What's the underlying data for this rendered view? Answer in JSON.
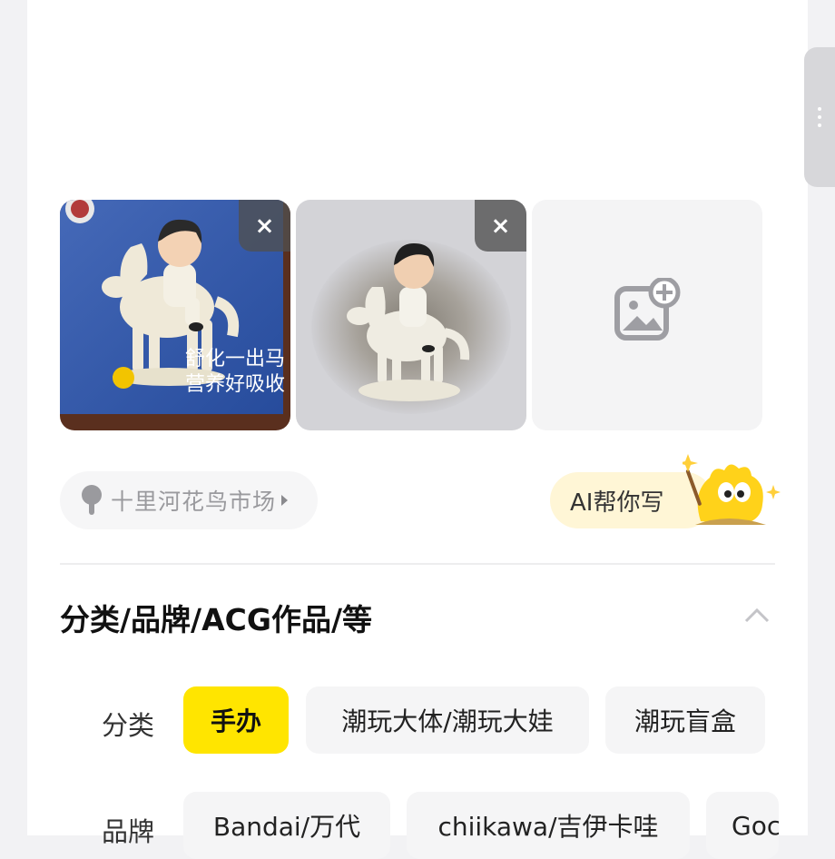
{
  "photos": [
    {
      "alt": "box figure photo",
      "close": "×",
      "box_text_line1": "舒化一出马",
      "box_text_line2": "营养好吸收"
    },
    {
      "alt": "figure photo",
      "close": "×"
    }
  ],
  "add_photo": {
    "icon": "add-image-icon"
  },
  "location": {
    "text": "十里河花鸟市场",
    "icon": "location-pin-icon"
  },
  "ai_writer": {
    "label": "AI帮你写"
  },
  "section": {
    "title": "分类/品牌/ACG作品/等"
  },
  "category_row": {
    "label": "分类",
    "chips": [
      {
        "label": "手办",
        "active": true
      },
      {
        "label": "潮玩大体/潮玩大娃",
        "active": false
      },
      {
        "label": "潮玩盲盒",
        "active": false
      }
    ]
  },
  "brand_row": {
    "label": "品牌",
    "chips": [
      {
        "label": "Bandai/万代"
      },
      {
        "label": "chiikawa/吉伊卡哇"
      },
      {
        "label": "Goc"
      }
    ]
  },
  "colors": {
    "accent": "#ffe500",
    "ai_bg": "#fff6d6",
    "chip_bg": "#f5f5f6"
  }
}
